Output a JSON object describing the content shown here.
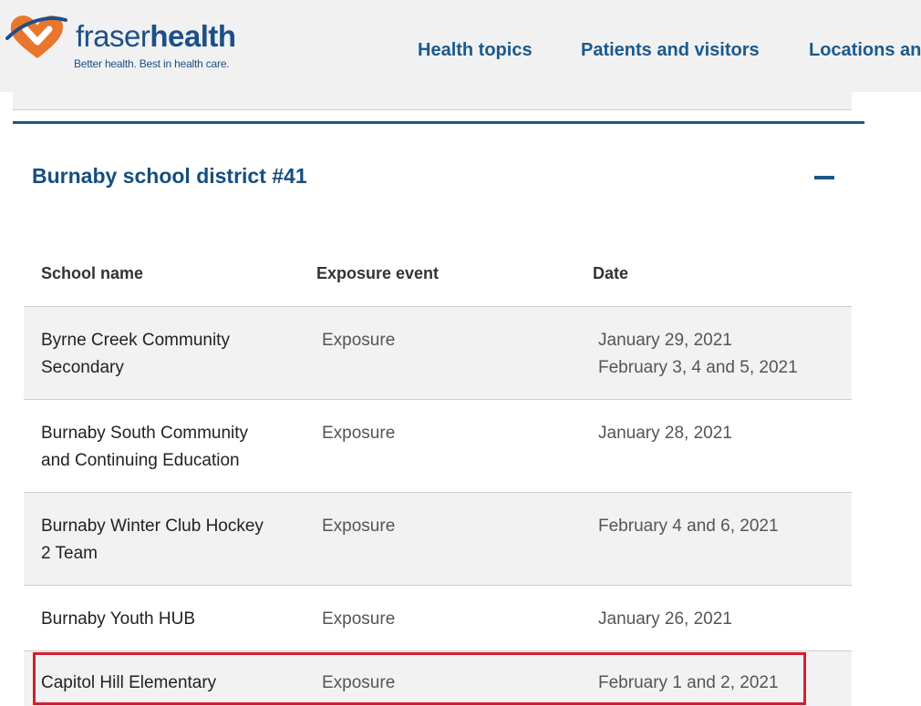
{
  "logo": {
    "name_part1": "fraser",
    "name_part2": "health",
    "tagline": "Better health. Best in health care."
  },
  "nav": [
    {
      "label": "Health topics"
    },
    {
      "label": "Patients and visitors"
    },
    {
      "label": "Locations an"
    }
  ],
  "section": {
    "title": "Burnaby school district #41"
  },
  "table": {
    "headers": [
      "School name",
      "Exposure event",
      "Date"
    ],
    "rows": [
      {
        "school": [
          " Byrne Creek Community",
          "Secondary"
        ],
        "event": "Exposure",
        "date": [
          "January 29, 2021",
          "February 3, 4 and 5, 2021"
        ]
      },
      {
        "school": [
          " Burnaby South Community",
          "and Continuing Education"
        ],
        "event": "Exposure",
        "date": [
          "January 28, 2021"
        ]
      },
      {
        "school": [
          " Burnaby Winter Club Hockey",
          "2 Team"
        ],
        "event": "Exposure",
        "date": [
          "February 4 and 6, 2021"
        ]
      },
      {
        "school": [
          " Burnaby Youth HUB"
        ],
        "event": "Exposure",
        "date": [
          "January 26, 2021"
        ]
      },
      {
        "school": [
          " Capitol Hill Elementary"
        ],
        "event": "Exposure",
        "date": [
          "February 1 and 2, 2021"
        ]
      }
    ]
  },
  "colors": {
    "brand_blue": "#1d4f88",
    "brand_orange": "#e8762c",
    "highlight_red": "#d32030"
  }
}
